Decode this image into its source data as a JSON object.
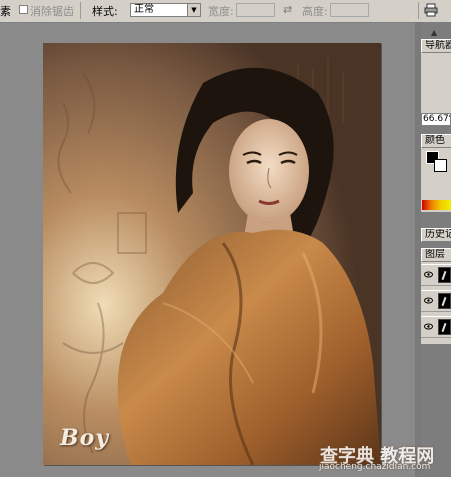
{
  "options_bar": {
    "cut_label": "素",
    "antialias_label": "消除锯齿",
    "style_label": "样式:",
    "style_value": "正常",
    "width_label": "宽度:",
    "height_label": "高度:",
    "swap_icon": "swap-arrows-icon",
    "print_icon": "printer-icon"
  },
  "palettes": {
    "navigator_tab": "导航器",
    "zoom_value": "66.67%",
    "color_tab": "颜色",
    "history_tab": "历史记",
    "layers_tab": "图层"
  },
  "image": {
    "logo_text": "Boy",
    "watermark_text": "查字典 教程网",
    "watermark_url": "jiaocheng.chazidian.com"
  },
  "colors": {
    "ui_face": "#d4d0c8",
    "workspace": "#8a8a8a",
    "sepia_dark": "#5a4030",
    "sepia_light": "#e8d2ac"
  }
}
